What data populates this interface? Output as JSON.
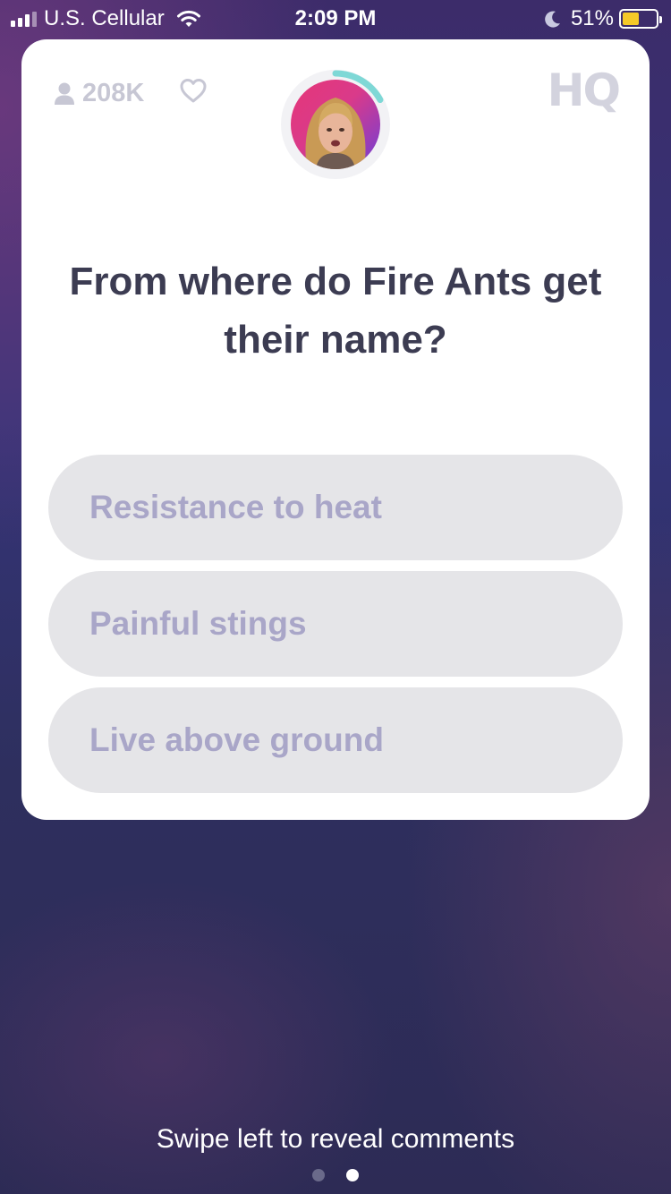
{
  "status_bar": {
    "carrier": "U.S. Cellular",
    "time": "2:09 PM",
    "battery_percent": "51%",
    "battery_level": 0.51,
    "icons": [
      "signal-icon",
      "wifi-icon",
      "moon-icon",
      "battery-icon"
    ]
  },
  "card": {
    "viewer_count": "208K",
    "logo_text": "HQ",
    "timer_progress": 0.17,
    "question": "From where do Fire Ants get their name?",
    "answers": [
      {
        "label": "Resistance to heat"
      },
      {
        "label": "Painful stings"
      },
      {
        "label": "Live above ground"
      }
    ]
  },
  "footer": {
    "hint": "Swipe left to reveal comments",
    "page_count": 2,
    "active_page": 2
  },
  "colors": {
    "answer_bg": "#e5e5e8",
    "answer_text": "#a9a6c8",
    "question_text": "#3c3c52",
    "timer_ring": "#7ed8d6",
    "battery_fill": "#f5c928"
  }
}
